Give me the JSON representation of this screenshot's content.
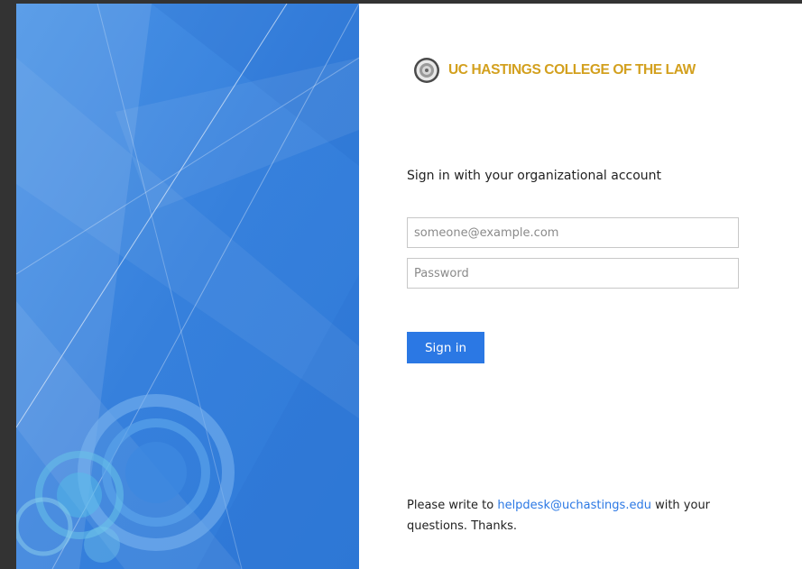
{
  "brand": {
    "name": "UC HASTINGS COLLEGE OF THE LAW",
    "seal_icon": "college-seal-icon",
    "name_color": "#d3a01e"
  },
  "login": {
    "heading": "Sign in with your organizational account",
    "email_placeholder": "someone@example.com",
    "email_value": "",
    "password_placeholder": "Password",
    "password_value": "",
    "submit_label": "Sign in",
    "accent_color": "#2b78e4"
  },
  "footer": {
    "text_before": "Please write to ",
    "link_text": "helpdesk@uchastings.edu",
    "text_after": " with your questions. Thanks."
  },
  "illustration": {
    "background_color": "#3b86e0"
  }
}
